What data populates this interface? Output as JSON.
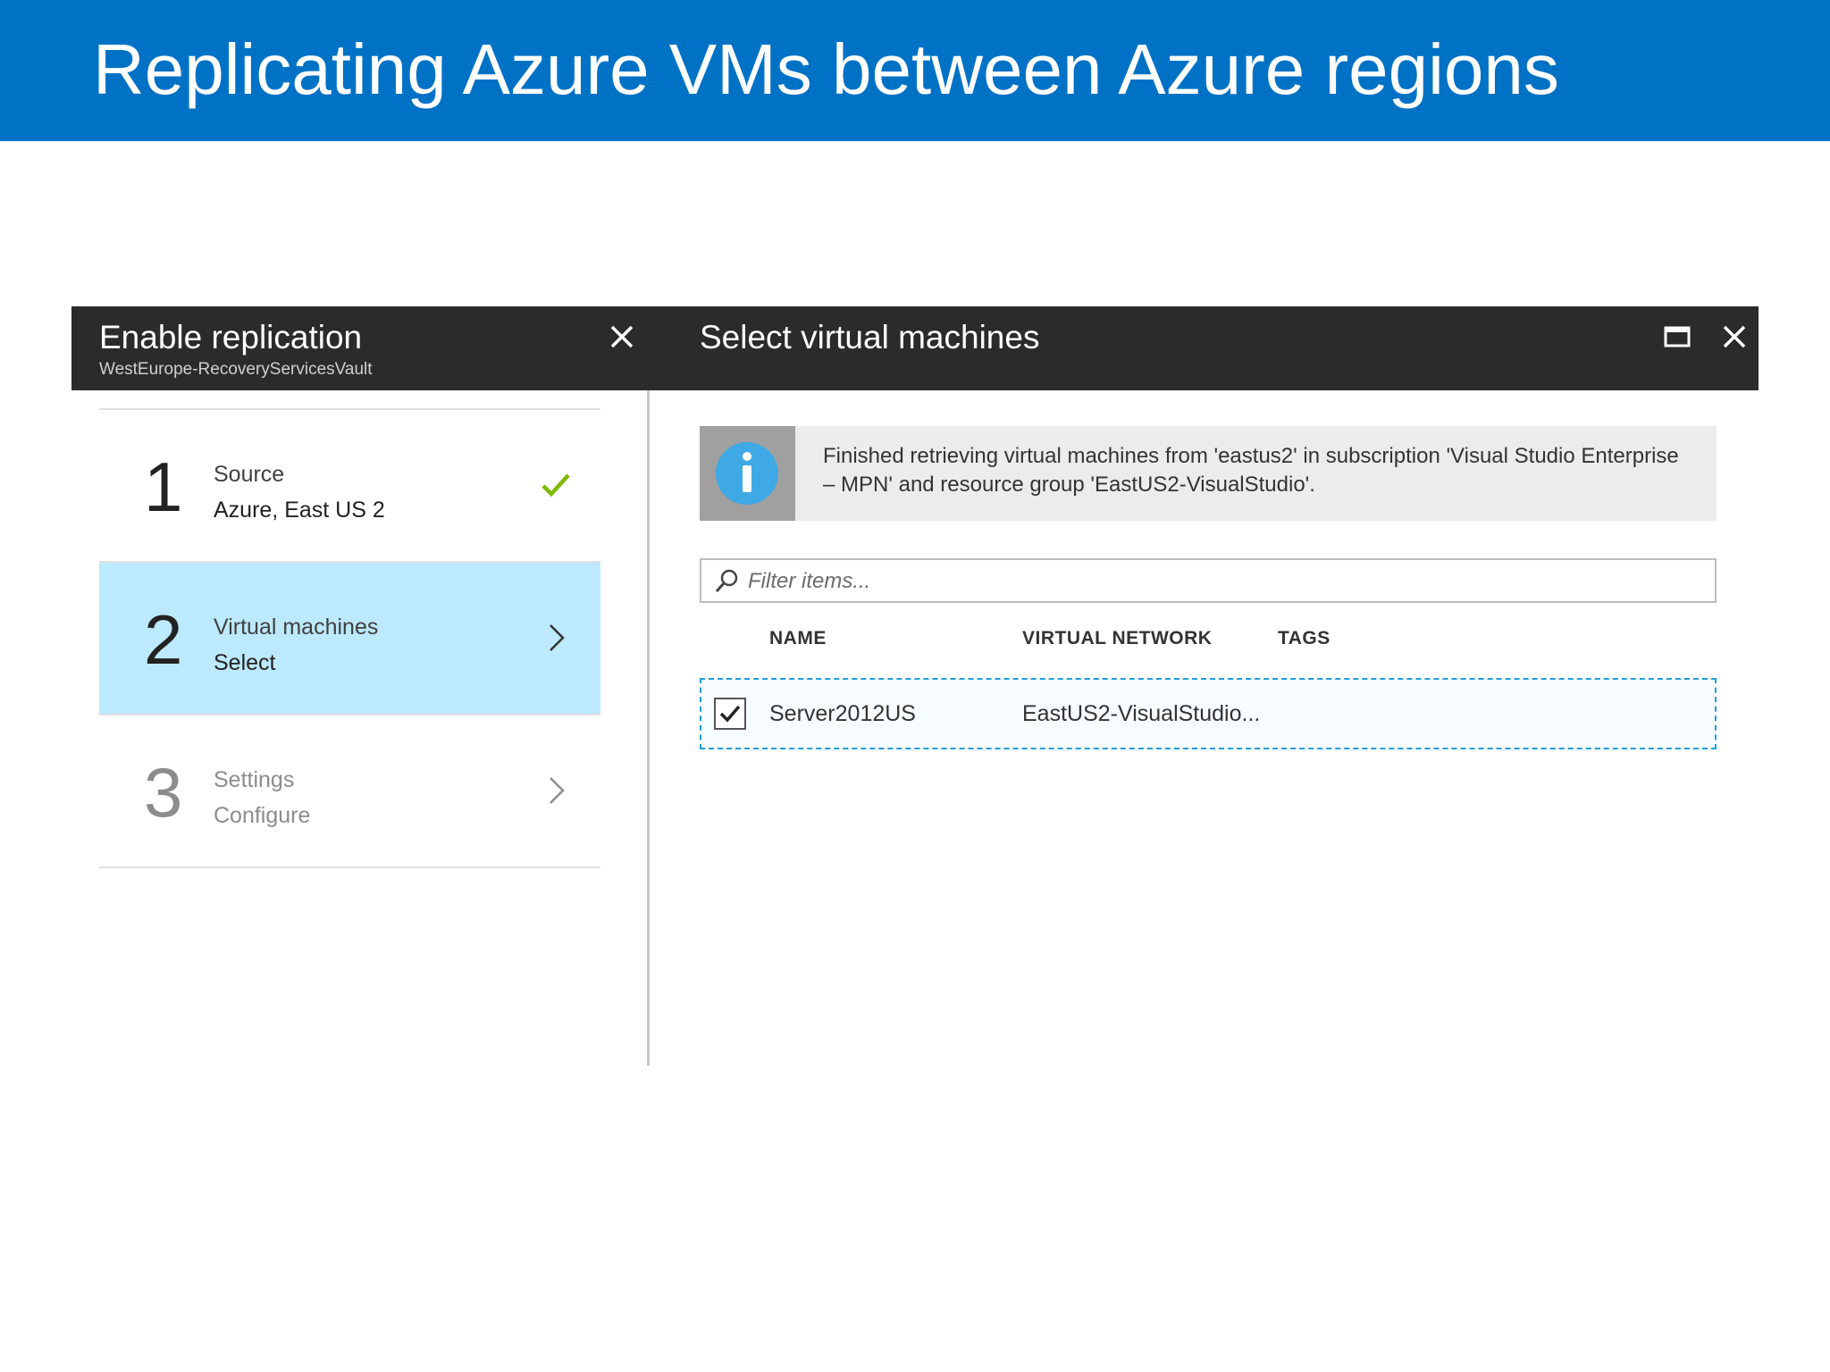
{
  "slide": {
    "title": "Replicating Azure VMs between Azure regions"
  },
  "colors": {
    "title_band": "#0072c6",
    "blade_header": "#2b2b2b",
    "active_step": "#bce9fb",
    "check_green": "#7fba00",
    "info_icon": "#3ea9e4",
    "selection_border": "#1f9ed7"
  },
  "left_blade": {
    "title": "Enable replication",
    "subtitle": "WestEurope-RecoveryServicesVault",
    "close_icon": "close-icon",
    "steps": [
      {
        "number": "1",
        "label": "Source",
        "value": "Azure, East US 2",
        "status_icon": "checkmark-icon",
        "state": "completed"
      },
      {
        "number": "2",
        "label": "Virtual machines",
        "value": "Select",
        "status_icon": "chevron-right-icon",
        "state": "active"
      },
      {
        "number": "3",
        "label": "Settings",
        "value": "Configure",
        "status_icon": "chevron-right-icon",
        "state": "disabled"
      }
    ]
  },
  "right_blade": {
    "title": "Select virtual machines",
    "maximize_icon": "maximize-icon",
    "close_icon": "close-icon",
    "info": {
      "icon": "info-icon",
      "message": "Finished retrieving virtual machines from 'eastus2' in subscription 'Visual Studio Enterprise – MPN' and resource group 'EastUS2-VisualStudio'."
    },
    "filter": {
      "placeholder": "Filter items...",
      "value": "",
      "icon": "search-icon"
    },
    "table": {
      "columns": [
        "NAME",
        "VIRTUAL NETWORK",
        "TAGS"
      ],
      "rows": [
        {
          "checked": true,
          "name": "Server2012US",
          "virtual_network": "EastUS2-VisualStudio...",
          "tags": ""
        }
      ]
    }
  }
}
